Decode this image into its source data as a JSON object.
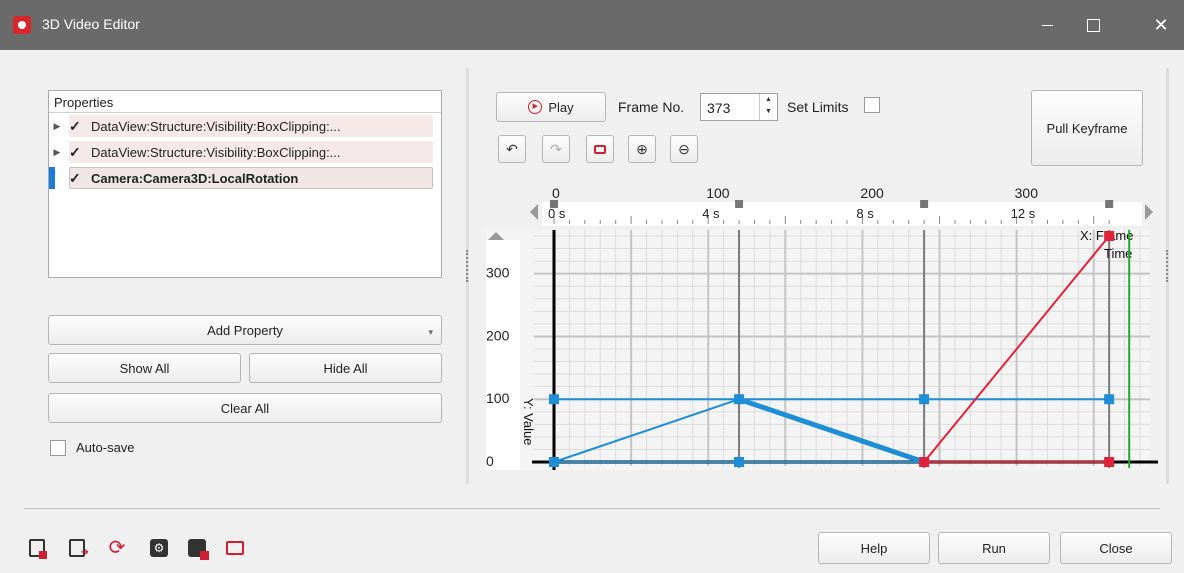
{
  "window": {
    "title": "3D Video Editor"
  },
  "properties": {
    "header": "Properties",
    "items": [
      {
        "label": "DataView:Structure:Visibility:BoxClipping:...",
        "checked": "✓",
        "selected": false
      },
      {
        "label": "DataView:Structure:Visibility:BoxClipping:...",
        "checked": "✓",
        "selected": false
      },
      {
        "label": "Camera:Camera3D:LocalRotation",
        "checked": "✓",
        "selected": true
      }
    ]
  },
  "buttons": {
    "add_property": "Add Property",
    "show_all": "Show All",
    "hide_all": "Hide All",
    "clear_all": "Clear All",
    "play": "Play",
    "pull_keyframe": "Pull Keyframe",
    "help": "Help",
    "run": "Run",
    "close": "Close"
  },
  "autosave": {
    "label": "Auto-save",
    "checked": false
  },
  "frame": {
    "label": "Frame No.",
    "value": "373"
  },
  "set_limits": {
    "label": "Set Limits",
    "checked": false
  },
  "icons": {
    "toolbar": [
      "undo-icon",
      "redo-icon",
      "fit-view-icon",
      "zoom-in-icon",
      "zoom-out-icon"
    ],
    "footer": [
      "save-project-icon",
      "export-video-icon",
      "refresh-render-icon",
      "settings-icon",
      "record-icon",
      "screen-capture-icon"
    ]
  },
  "colors": {
    "title_bar": "#6a6a6a",
    "accent": "#1e7cd6",
    "blue_series": "#1e8fd6",
    "red_series": "#e0223a",
    "current_frame": "#22a822"
  },
  "chart_data": {
    "type": "line",
    "xlabel": "X: Frame",
    "xlabel2": "Time",
    "ylabel": "Y: Value",
    "x_ticks": [
      "0",
      "100",
      "200",
      "300"
    ],
    "time_ticks": [
      "0 s",
      "4 s",
      "8 s",
      "12 s"
    ],
    "y_ticks": [
      "0",
      "100",
      "200",
      "300"
    ],
    "xlim": [
      0,
      380
    ],
    "ylim": [
      0,
      360
    ],
    "keyframes_x": [
      0,
      120,
      240,
      360
    ],
    "current_frame": 373,
    "series": [
      {
        "color": "#1e8fd6",
        "points": [
          [
            0,
            0
          ],
          [
            120,
            100
          ],
          [
            240,
            0
          ]
        ]
      },
      {
        "color": "#1e8fd6",
        "points": [
          [
            0,
            100
          ],
          [
            360,
            100
          ]
        ]
      },
      {
        "color": "#1e8fd6",
        "points": [
          [
            0,
            0
          ],
          [
            360,
            0
          ]
        ]
      },
      {
        "color": "#1e8fd6",
        "points": [
          [
            120,
            100
          ],
          [
            240,
            0
          ]
        ],
        "bold": true
      },
      {
        "color": "#e0223a",
        "points": [
          [
            240,
            0
          ],
          [
            360,
            360
          ]
        ]
      },
      {
        "color": "#e0223a",
        "points": [
          [
            240,
            0
          ],
          [
            360,
            0
          ]
        ]
      }
    ],
    "markers": [
      {
        "x": 0,
        "y": 0,
        "color": "#1e8fd6"
      },
      {
        "x": 120,
        "y": 0,
        "color": "#1e8fd6"
      },
      {
        "x": 0,
        "y": 100,
        "color": "#1e8fd6"
      },
      {
        "x": 120,
        "y": 100,
        "color": "#1e8fd6"
      },
      {
        "x": 240,
        "y": 100,
        "color": "#1e8fd6"
      },
      {
        "x": 360,
        "y": 100,
        "color": "#1e8fd6"
      },
      {
        "x": 240,
        "y": 0,
        "color": "#e0223a"
      },
      {
        "x": 360,
        "y": 0,
        "color": "#e0223a"
      },
      {
        "x": 360,
        "y": 360,
        "color": "#e0223a"
      }
    ]
  }
}
